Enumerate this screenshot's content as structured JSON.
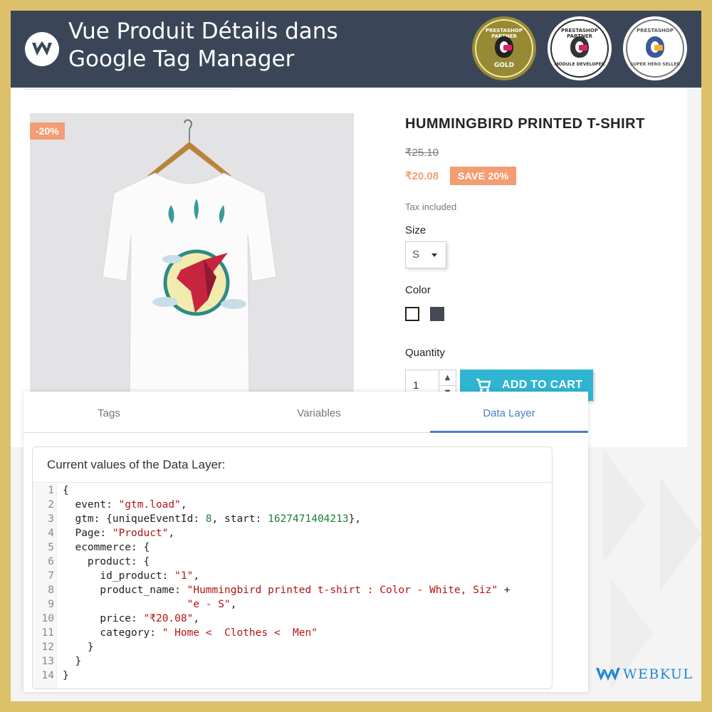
{
  "header": {
    "title_line1": "Vue Produit Détails dans",
    "title_line2": "Google Tag Manager",
    "badges": [
      {
        "line1": "PRESTASHOP PARTNER",
        "line2": "GOLD"
      },
      {
        "line1": "PRESTASHOP PARTNER",
        "line2": "MODULE DEVELOPER"
      },
      {
        "line1": "PRESTASHOP",
        "line2": "SUPER HERO SELLER"
      }
    ]
  },
  "product": {
    "discount_flag": "-20%",
    "name": "HUMMINGBIRD PRINTED T-SHIRT",
    "old_price": "₹25.10",
    "new_price": "₹20.08",
    "save_label": "SAVE 20%",
    "tax_note": "Tax included",
    "size_label": "Size",
    "size_value": "S",
    "color_label": "Color",
    "colors": [
      "#ffffff",
      "#434a56"
    ],
    "quantity_label": "Quantity",
    "quantity_value": "1",
    "add_to_cart_label": "ADD TO CART"
  },
  "gtm": {
    "tabs": [
      "Tags",
      "Variables",
      "Data Layer"
    ],
    "active_tab": "Data Layer",
    "panel_title": "Current values of the Data Layer:",
    "code_lines": [
      {
        "n": "1",
        "t": "{"
      },
      {
        "n": "2",
        "t": "  event: \"gtm.load\","
      },
      {
        "n": "3",
        "t": "  gtm: {uniqueEventId: 8, start: 1627471404213},"
      },
      {
        "n": "4",
        "t": "  Page: \"Product\","
      },
      {
        "n": "5",
        "t": "  ecommerce: {"
      },
      {
        "n": "6",
        "t": "    product: {"
      },
      {
        "n": "7",
        "t": "      id_product: \"1\","
      },
      {
        "n": "8",
        "t": "      product_name: \"Hummingbird printed t-shirt : Color - White, Siz\" +"
      },
      {
        "n": "9",
        "t": "                    \"e - S\","
      },
      {
        "n": "10",
        "t": "      price: \"₹20.08\","
      },
      {
        "n": "11",
        "t": "      category: \" Home <  Clothes <  Men\""
      },
      {
        "n": "12",
        "t": "    }"
      },
      {
        "n": "13",
        "t": "  }"
      },
      {
        "n": "14",
        "t": "}"
      }
    ]
  },
  "branding": {
    "company": "WEBKUL",
    "accent": "#1d87d6",
    "frame_color": "#dcc16a",
    "header_color": "#3a4658",
    "button_color": "#2fb5d2",
    "sale_color": "#f39d72"
  }
}
